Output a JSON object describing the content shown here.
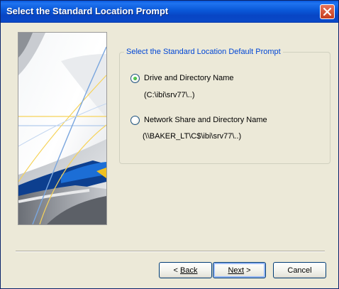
{
  "window": {
    "title": "Select the Standard Location Prompt"
  },
  "group": {
    "title": "Select the Standard Location Default Prompt",
    "options": [
      {
        "label": "Drive and Directory Name",
        "path": "(C:\\ibi\\srv77\\..)",
        "selected": true
      },
      {
        "label": "Network Share and Directory Name",
        "path": "(\\\\BAKER_LT\\C$\\ibi\\srv77\\..)",
        "selected": false
      }
    ]
  },
  "buttons": {
    "back_arrow": "<",
    "back_label": "Back",
    "next_label": "Next",
    "next_arrow": ">",
    "cancel_label": "Cancel"
  },
  "icons": {
    "close": "close-x-icon",
    "radio_selected_color": "#21a121"
  }
}
